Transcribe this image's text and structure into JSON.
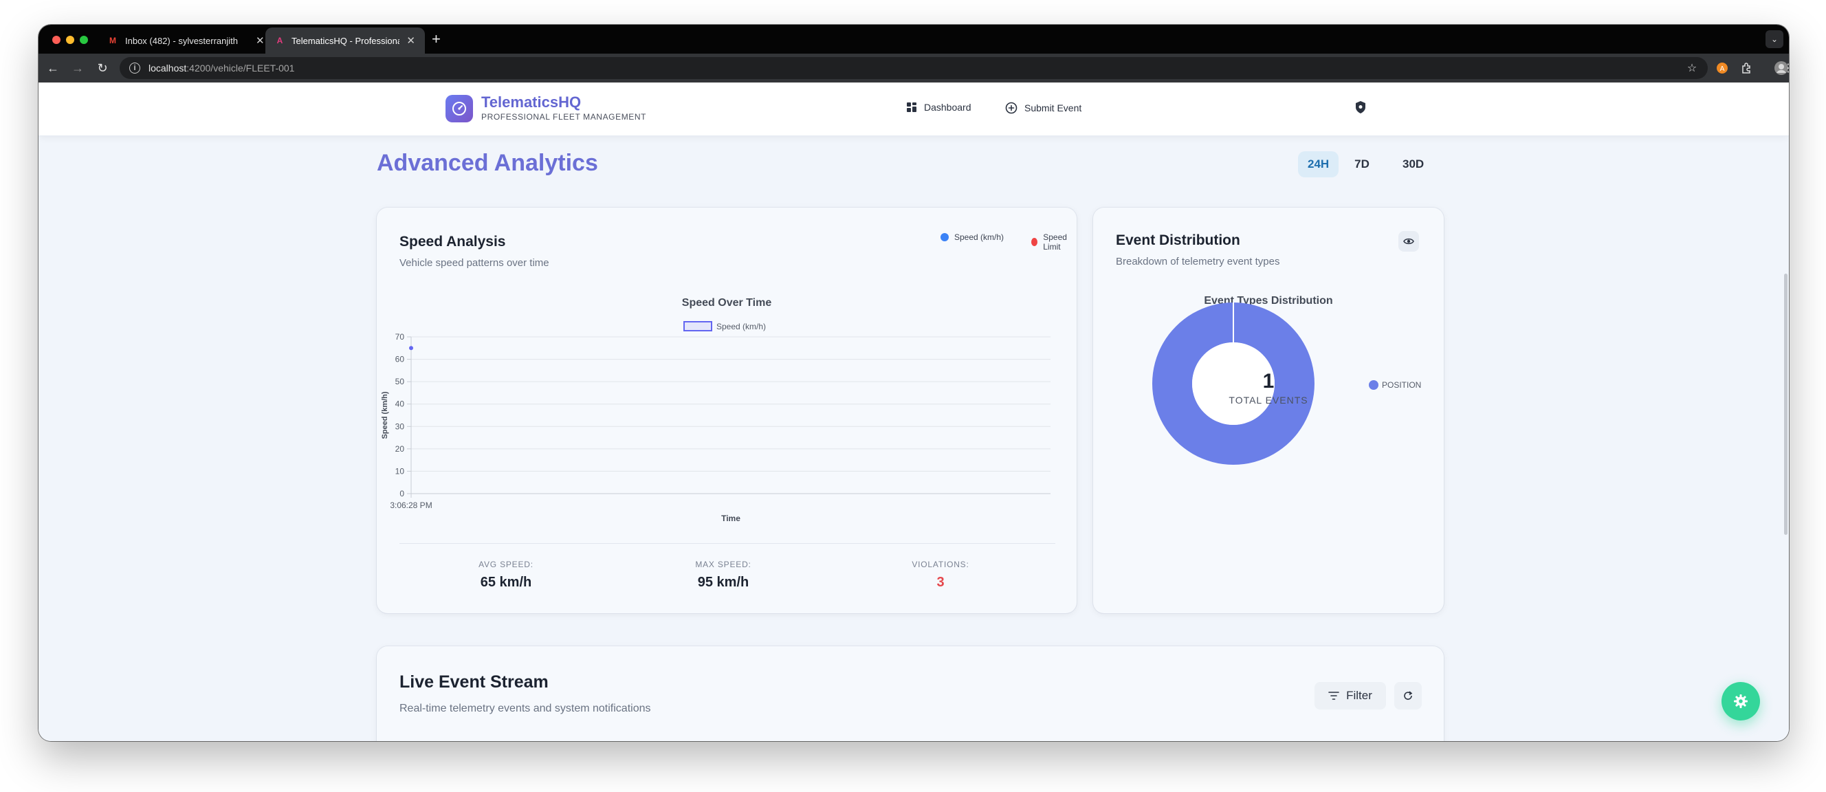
{
  "browser": {
    "tabs": [
      {
        "label": "Inbox (482) - sylvesterranjith",
        "favicon": "M"
      },
      {
        "label": "TelematicsHQ - Professional F",
        "favicon": "A"
      }
    ],
    "url_host": "localhost",
    "url_path": ":4200/vehicle/FLEET-001"
  },
  "header": {
    "brand": "TelematicsHQ",
    "brand_subtitle": "PROFESSIONAL FLEET MANAGEMENT",
    "nav": [
      {
        "label": "Dashboard",
        "icon": "grid-icon"
      },
      {
        "label": "Submit Event",
        "icon": "plus-circle-icon"
      }
    ]
  },
  "analytics": {
    "title": "Advanced Analytics",
    "ranges": [
      "24H",
      "7D",
      "30D"
    ],
    "active_range": "24H"
  },
  "speed_card": {
    "title": "Speed Analysis",
    "subtitle": "Vehicle speed patterns over time",
    "legend": [
      {
        "label": "Speed (km/h)",
        "color": "#3b82f6"
      },
      {
        "label": "Speed Limit",
        "color": "#ef4444"
      }
    ],
    "stats": [
      {
        "label": "AVG SPEED:",
        "value": "65 km/h",
        "color": "#1c2330"
      },
      {
        "label": "MAX SPEED:",
        "value": "95 km/h",
        "color": "#1c2330"
      },
      {
        "label": "VIOLATIONS:",
        "value": "3",
        "color": "#e5484d"
      }
    ]
  },
  "event_card": {
    "title": "Event Distribution",
    "subtitle": "Breakdown of telemetry event types",
    "chart_title": "Event Types Distribution",
    "center_value": "1",
    "center_label": "TOTAL EVENTS",
    "legend_label": "POSITION"
  },
  "stream_card": {
    "title": "Live Event Stream",
    "subtitle": "Real-time telemetry events and system notifications",
    "filter_label": "Filter"
  },
  "chart_data": [
    {
      "type": "line",
      "title": "Speed Over Time",
      "xlabel": "Time",
      "ylabel": "Speed (km/h)",
      "ylim": [
        0,
        70
      ],
      "yticks": [
        0,
        10,
        20,
        30,
        40,
        50,
        60,
        70
      ],
      "categories": [
        "3:06:28 PM"
      ],
      "series": [
        {
          "name": "Speed (km/h)",
          "values": [
            65
          ],
          "color": "#6366f1"
        }
      ],
      "grid": true,
      "legend": "top"
    },
    {
      "type": "pie",
      "title": "Event Types Distribution",
      "categories": [
        "POSITION"
      ],
      "values": [
        1
      ],
      "colors": [
        "#6b7fe8"
      ],
      "legend": "right"
    }
  ]
}
